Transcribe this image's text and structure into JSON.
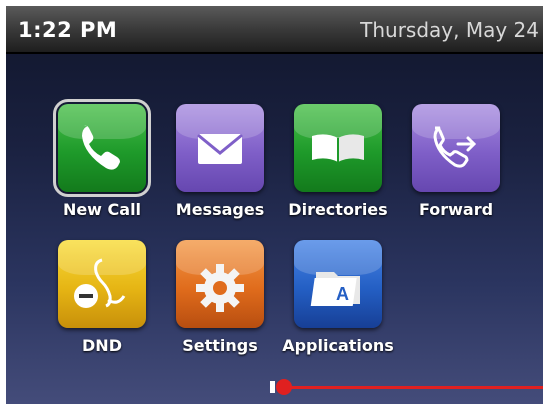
{
  "status": {
    "time": "1:22 PM",
    "date": "Thursday, May 24"
  },
  "apps": [
    {
      "label": "New Call",
      "icon": "phone-icon",
      "color": "#1e9a2a",
      "selected": true
    },
    {
      "label": "Messages",
      "icon": "envelope-icon",
      "color": "#7f5fc8"
    },
    {
      "label": "Directories",
      "icon": "open-book-icon",
      "color": "#1e9a2a"
    },
    {
      "label": "Forward",
      "icon": "forward-call-icon",
      "color": "#7f5fc8"
    },
    {
      "label": "DND",
      "icon": "do-not-disturb-icon",
      "color": "#e6b514"
    },
    {
      "label": "Settings",
      "icon": "gear-icon",
      "color": "#e06c1c"
    },
    {
      "label": "Applications",
      "icon": "applications-folder-icon",
      "color": "#245fc4"
    }
  ],
  "pager": {
    "page_indicator_color": "#e02020"
  }
}
